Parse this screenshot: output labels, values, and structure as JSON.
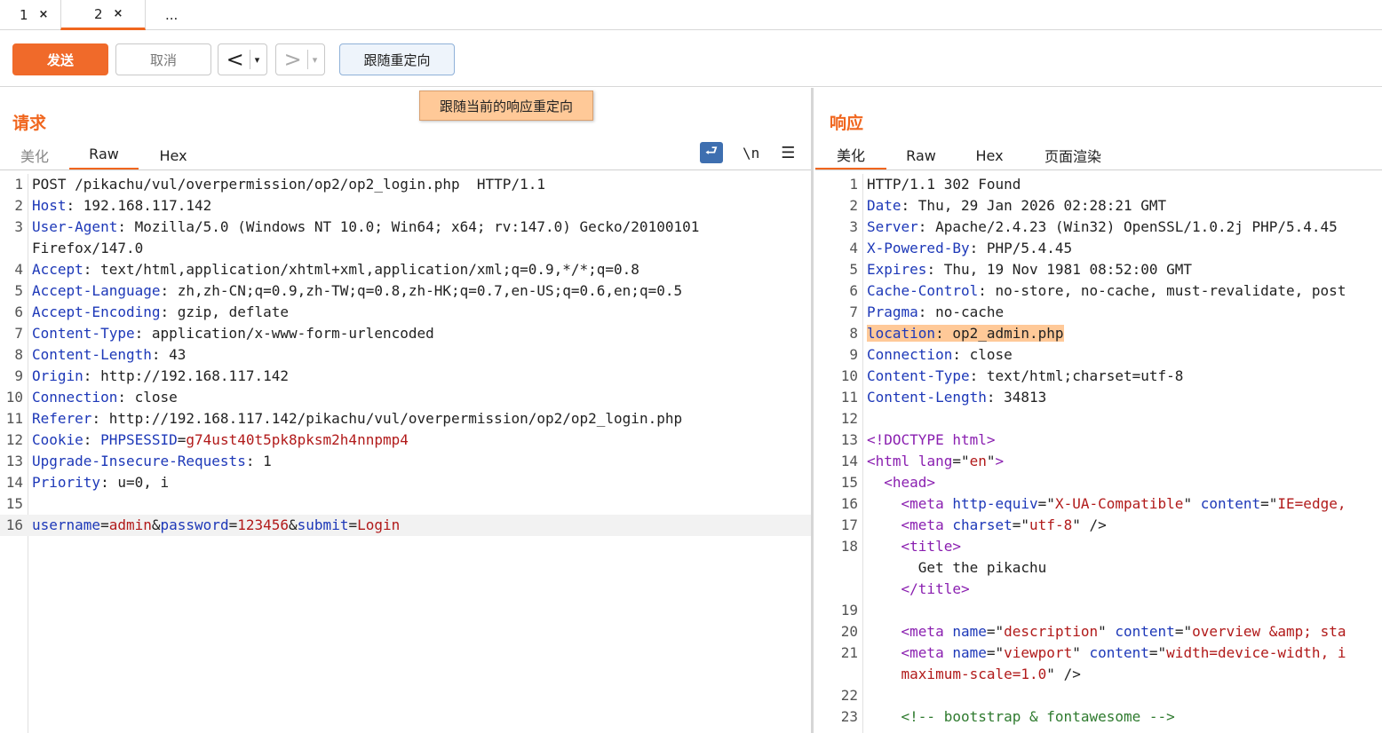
{
  "tabs": [
    {
      "label": "1",
      "close": "×"
    },
    {
      "label": "2",
      "close": "×"
    },
    {
      "label": "..."
    }
  ],
  "toolbar": {
    "send": "发送",
    "cancel": "取消",
    "back": "<",
    "forward": ">",
    "caret": "▾",
    "follow_redirect": "跟随重定向",
    "tooltip": "跟随当前的响应重定向"
  },
  "request": {
    "title": "请求",
    "tabs": [
      "美化",
      "Raw",
      "Hex"
    ],
    "active_tab": "Raw",
    "icons": {
      "wrap": "wrap-icon",
      "newline": "\\n",
      "menu": "☰"
    },
    "lines": [
      {
        "n": "1",
        "plain": "POST /pikachu/vul/overpermission/op2/op2_login.php  HTTP/1.1"
      },
      {
        "n": "2",
        "k": "Host",
        "plain": ": 192.168.117.142"
      },
      {
        "n": "3",
        "k": "User-Agent",
        "plain": ": Mozilla/5.0 (Windows NT 10.0; Win64; x64; rv:147.0) Gecko/20100101"
      },
      {
        "n": "",
        "plain": "Firefox/147.0"
      },
      {
        "n": "4",
        "k": "Accept",
        "plain": ": text/html,application/xhtml+xml,application/xml;q=0.9,*/*;q=0.8"
      },
      {
        "n": "5",
        "k": "Accept-Language",
        "plain": ": zh,zh-CN;q=0.9,zh-TW;q=0.8,zh-HK;q=0.7,en-US;q=0.6,en;q=0.5"
      },
      {
        "n": "6",
        "k": "Accept-Encoding",
        "plain": ": gzip, deflate"
      },
      {
        "n": "7",
        "k": "Content-Type",
        "plain": ": application/x-www-form-urlencoded"
      },
      {
        "n": "8",
        "k": "Content-Length",
        "plain": ": 43"
      },
      {
        "n": "9",
        "k": "Origin",
        "plain": ": http://192.168.117.142"
      },
      {
        "n": "10",
        "k": "Connection",
        "plain": ": close"
      },
      {
        "n": "11",
        "k": "Referer",
        "plain": ": http://192.168.117.142/pikachu/vul/overpermission/op2/op2_login.php"
      },
      {
        "n": "12",
        "k": "Cookie",
        "plain": ": ",
        "k2": "PHPSESSID",
        "eq": "=",
        "v": "g74ust40t5pk8pksm2h4nnpmp4"
      },
      {
        "n": "13",
        "k": "Upgrade-Insecure-Requests",
        "plain": ": 1"
      },
      {
        "n": "14",
        "k": "Priority",
        "plain": ": u=0, i"
      },
      {
        "n": "15",
        "plain": ""
      },
      {
        "n": "16",
        "body": true,
        "p1k": "username",
        "p1v": "admin",
        "p2k": "password",
        "p2v": "123456",
        "p3k": "submit",
        "p3v": "Login"
      }
    ]
  },
  "response": {
    "title": "响应",
    "tabs": [
      "美化",
      "Raw",
      "Hex",
      "页面渲染"
    ],
    "active_tab": "美化",
    "lines": [
      {
        "n": "1",
        "plain": "HTTP/1.1 302 Found"
      },
      {
        "n": "2",
        "k": "Date",
        "plain": ": Thu, 29 Jan 2026 02:28:21 GMT"
      },
      {
        "n": "3",
        "k": "Server",
        "plain": ": Apache/2.4.23 (Win32) OpenSSL/1.0.2j PHP/5.4.45"
      },
      {
        "n": "4",
        "k": "X-Powered-By",
        "plain": ": PHP/5.4.45"
      },
      {
        "n": "5",
        "k": "Expires",
        "plain": ": Thu, 19 Nov 1981 08:52:00 GMT"
      },
      {
        "n": "6",
        "k": "Cache-Control",
        "plain": ": no-store, no-cache, must-revalidate, post"
      },
      {
        "n": "7",
        "k": "Pragma",
        "plain": ": no-cache"
      },
      {
        "n": "8",
        "k": "location",
        "plain": ": op2_admin.php",
        "highlight": true
      },
      {
        "n": "9",
        "k": "Connection",
        "plain": ": close"
      },
      {
        "n": "10",
        "k": "Content-Type",
        "plain": ": text/html;charset=utf-8"
      },
      {
        "n": "11",
        "k": "Content-Length",
        "plain": ": 34813"
      },
      {
        "n": "12",
        "plain": ""
      },
      {
        "n": "13",
        "html": "<span class=\"t\">&lt;!DOCTYPE html&gt;</span>"
      },
      {
        "n": "14",
        "html": "<span class=\"t\">&lt;html</span> <span class=\"t\">lang</span>=\"<span class=\"s\">en</span>\"<span class=\"t\">&gt;</span>"
      },
      {
        "n": "15",
        "html": "  <span class=\"t\">&lt;head&gt;</span>"
      },
      {
        "n": "16",
        "html": "    <span class=\"t\">&lt;meta</span> <span class=\"k\">http-equiv</span>=\"<span class=\"s\">X-UA-Compatible</span>\" <span class=\"k\">content</span>=\"<span class=\"s\">IE=edge,</span>"
      },
      {
        "n": "17",
        "html": "    <span class=\"t\">&lt;meta</span> <span class=\"k\">charset</span>=\"<span class=\"s\">utf-8</span>\" /&gt;"
      },
      {
        "n": "18",
        "html": "    <span class=\"t\">&lt;title&gt;</span>"
      },
      {
        "n": "",
        "html": "      Get the pikachu"
      },
      {
        "n": "",
        "html": "    <span class=\"t\">&lt;/title&gt;</span>"
      },
      {
        "n": "19",
        "html": ""
      },
      {
        "n": "20",
        "html": "    <span class=\"t\">&lt;meta</span> <span class=\"k\">name</span>=\"<span class=\"s\">description</span>\" <span class=\"k\">content</span>=\"<span class=\"s\">overview &amp;amp; sta</span>"
      },
      {
        "n": "21",
        "html": "    <span class=\"t\">&lt;meta</span> <span class=\"k\">name</span>=\"<span class=\"s\">viewport</span>\" <span class=\"k\">content</span>=\"<span class=\"s\">width=device-width, i</span>"
      },
      {
        "n": "",
        "html": "    <span class=\"s\">maximum-scale=1.0</span>\" /&gt;"
      },
      {
        "n": "22",
        "html": ""
      },
      {
        "n": "23",
        "html": "    <span class=\"g\">&lt;!-- bootstrap &amp; fontawesome --&gt;</span>"
      }
    ]
  }
}
